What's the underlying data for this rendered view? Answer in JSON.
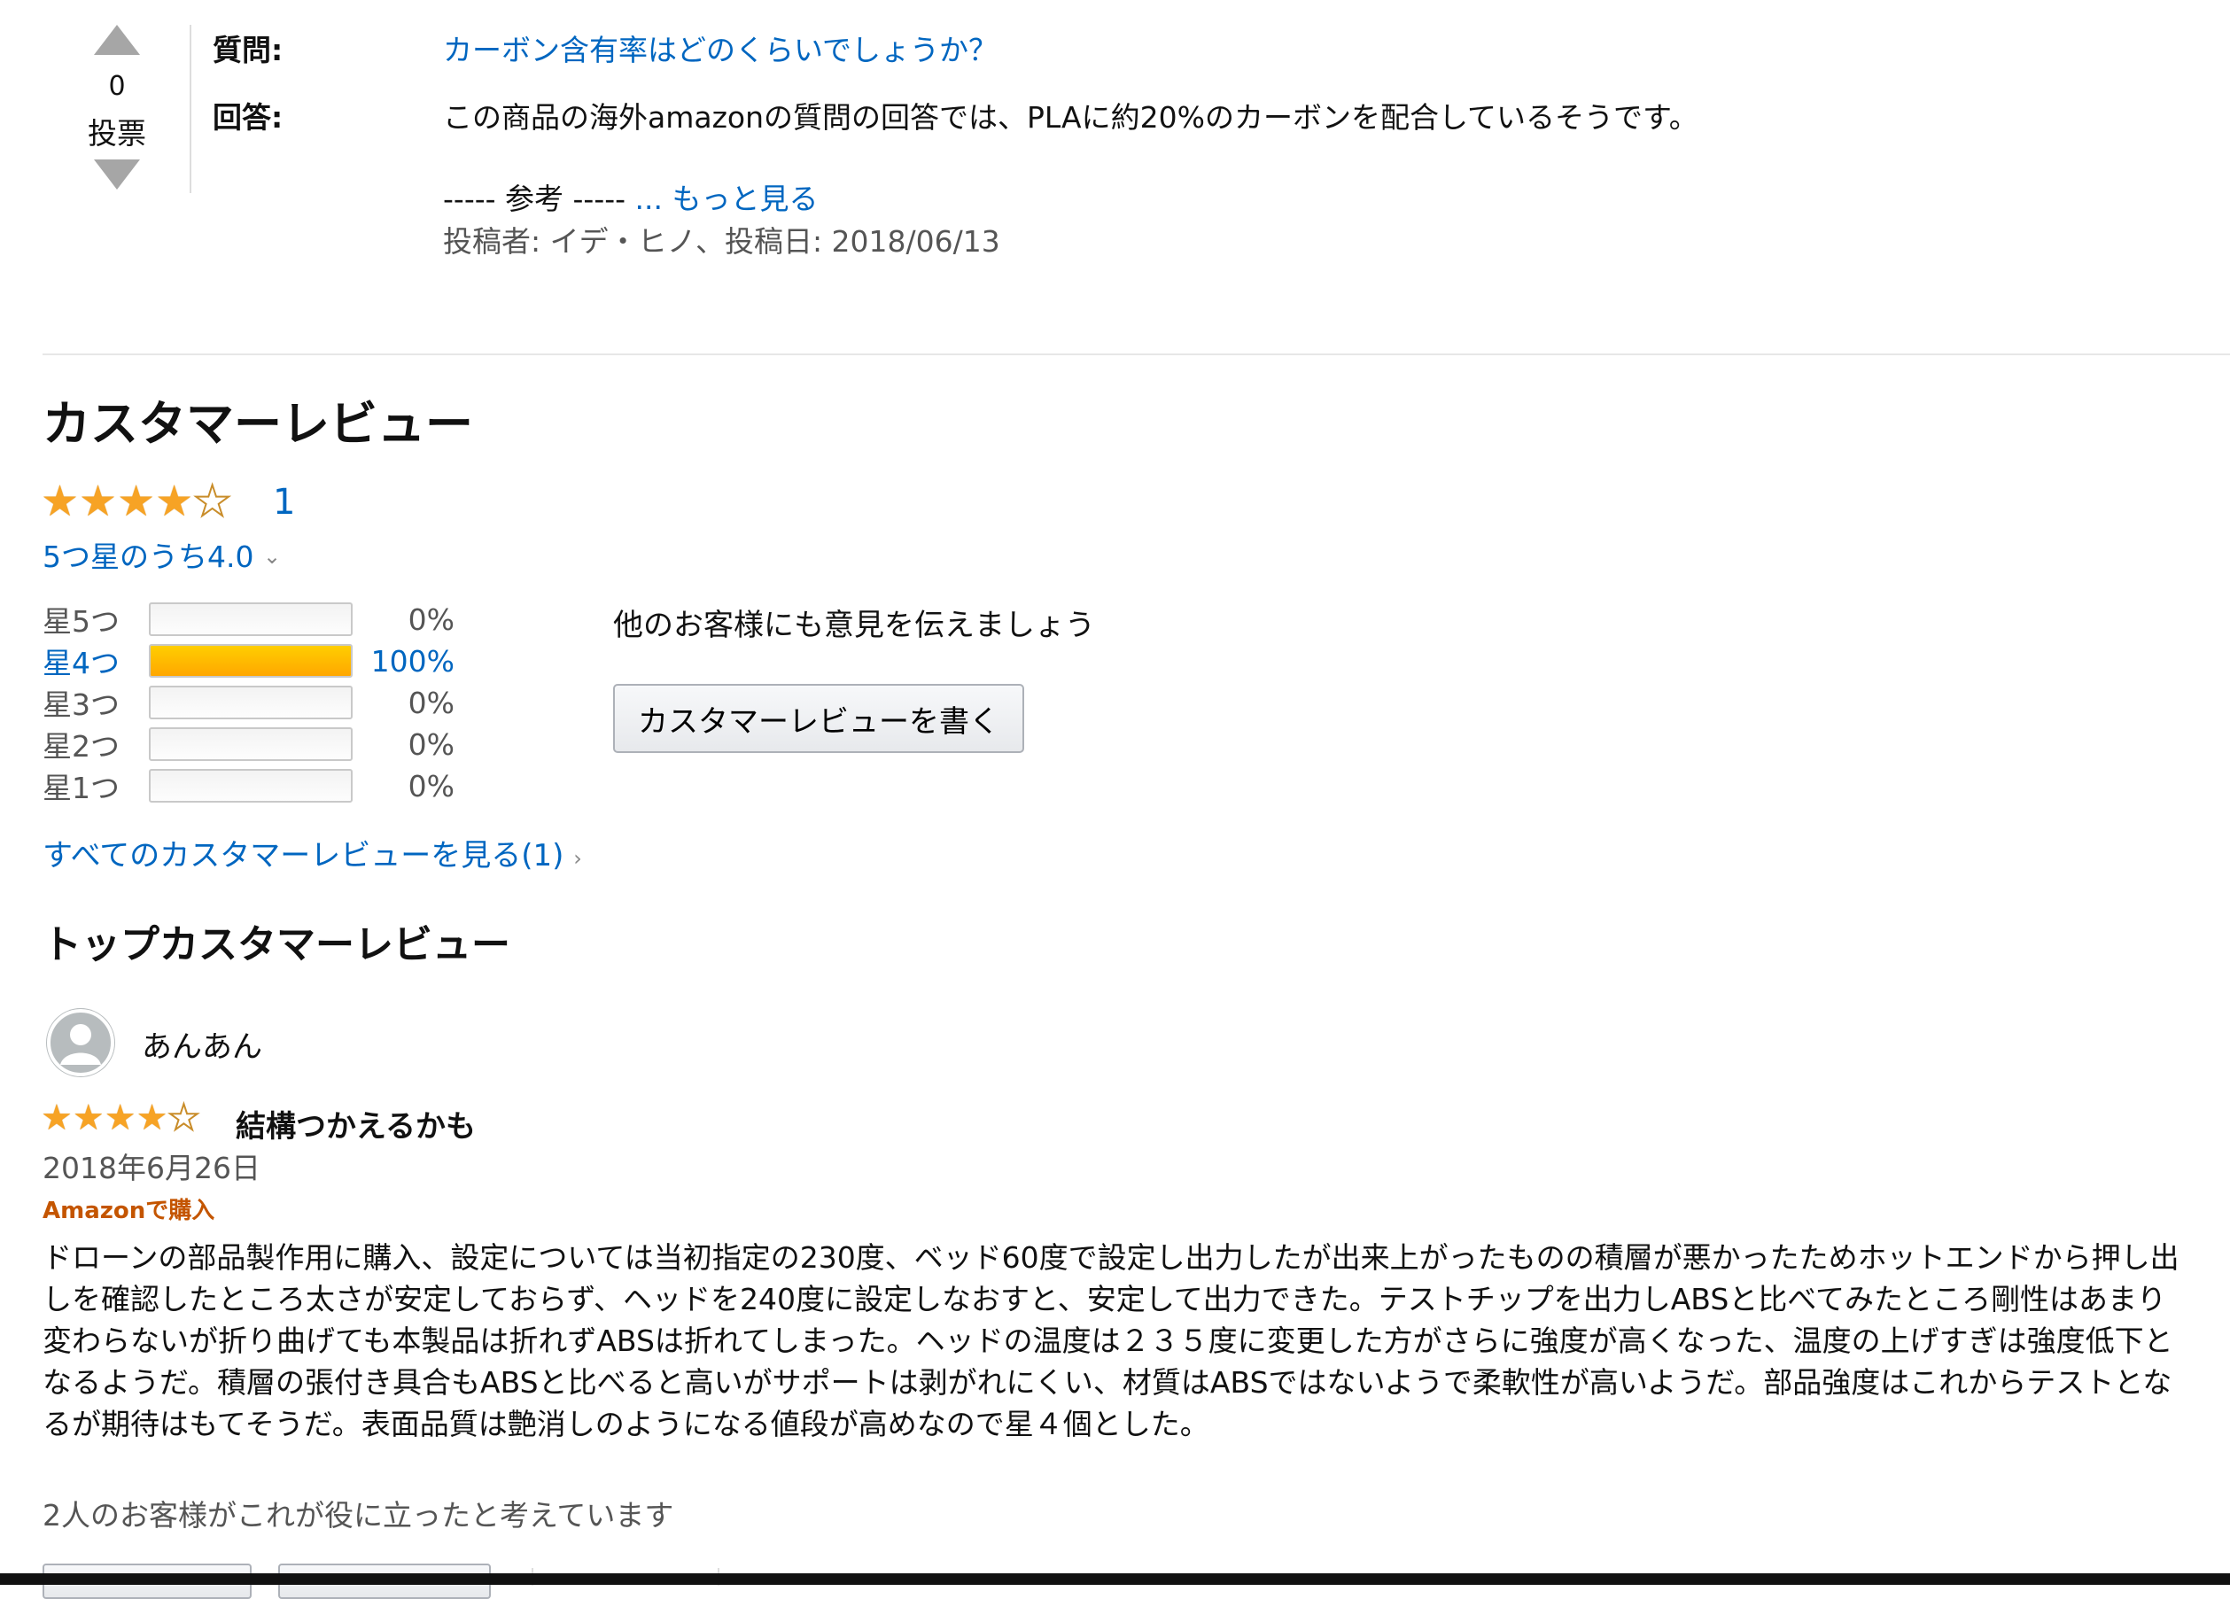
{
  "qa": {
    "votes": "0",
    "votes_unit": "投票",
    "question_label": "質問:",
    "question_text": "カーボン含有率はどのくらいでしょうか？",
    "answer_label": "回答:",
    "answer_text": "この商品の海外amazonの質問の回答では、PLAに約20%のカーボンを配合しているそうです。",
    "reference_text": "----- 参考 ----- ",
    "more_link": "... もっと見る",
    "posted_by": "投稿者: イデ・ヒノ、投稿日: 2018/06/13"
  },
  "reviews": {
    "title": "カスタマーレビュー",
    "rating": 4.0,
    "review_count": "1",
    "rating_text": "5つ星のうち4.0",
    "histogram": [
      {
        "label": "星5つ",
        "percent": 0,
        "percent_text": "0%"
      },
      {
        "label": "星4つ",
        "percent": 100,
        "percent_text": "100%"
      },
      {
        "label": "星3つ",
        "percent": 0,
        "percent_text": "0%"
      },
      {
        "label": "星2つ",
        "percent": 0,
        "percent_text": "0%"
      },
      {
        "label": "星1つ",
        "percent": 0,
        "percent_text": "0%"
      }
    ],
    "share_prompt": "他のお客様にも意見を伝えましょう",
    "write_button": "カスタマーレビューを書く",
    "see_all_link": "すべてのカスタマーレビューを見る(1)"
  },
  "top_reviews": {
    "title": "トップカスタマーレビュー",
    "items": [
      {
        "author": "あんあん",
        "rating": 4,
        "headline": "結構つかえるかも",
        "date": "2018年6月26日",
        "badge": "Amazonで購入",
        "body": "ドローンの部品製作用に購入、設定については当初指定の230度、ベッド60度で設定し出力したが出来上がったものの積層が悪かったためホットエンドから押し出しを確認したところ太さが安定しておらず、ヘッドを240度に設定しなおすと、安定して出力できた。テストチップを出力しABSと比べてみたところ剛性はあまり変わらないが折り曲げても本製品は折れずABSは折れてしまった。ヘッドの温度は２３５度に変更した方がさらに強度が高くなった、温度の上げすぎは強度低下となるようだ。積層の張付き具合もABSと比べると高いがサポートは剥がれにくい、材質はABSではないようで柔軟性が高いようだ。部品強度はこれからテストとなるが期待はもてそうだ。表面品質は艶消しのようになる値段が高めなので星４個とした。",
        "helpful": "2人のお客様がこれが役に立ったと考えています"
      }
    ]
  },
  "colors": {
    "link": "#0066c0",
    "star": "#f7a325",
    "bar_fill": "#ffa700",
    "badge": "#c45500"
  },
  "icons": {
    "vote_up": "triangle-up-icon",
    "vote_down": "triangle-down-icon",
    "chevron": "chevron-down-icon",
    "chevron_right": "chevron-right-icon",
    "avatar": "user-avatar-icon"
  }
}
